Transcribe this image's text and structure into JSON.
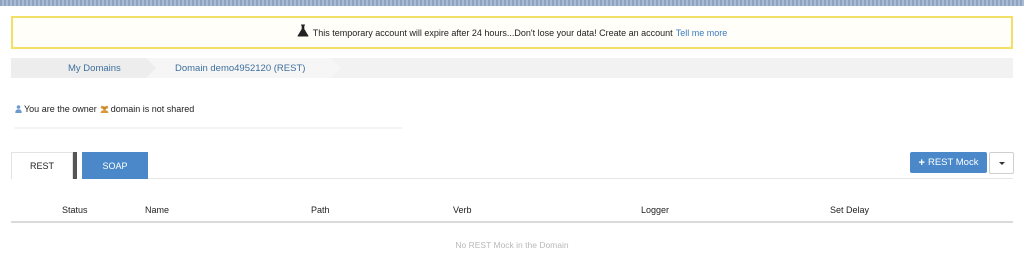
{
  "alert": {
    "message": "This temporary account will expire after 24 hours...Don't lose your data! Create an account",
    "link": "Tell me more",
    "icon": "flask-icon"
  },
  "breadcrumb": {
    "items": [
      {
        "label": "My Domains"
      },
      {
        "label": "Domain demo4952120 (REST)"
      }
    ]
  },
  "owner": {
    "owner_text": "You are the owner",
    "share_text": "domain is not shared",
    "user_icon": "user-icon",
    "share_icon": "group-icon"
  },
  "tabs": [
    {
      "label": "REST",
      "active": true
    },
    {
      "label": "SOAP",
      "active": false
    }
  ],
  "toolbar": {
    "add_label": "REST Mock",
    "add_icon": "plus-icon",
    "dropdown_icon": "caret-down-icon"
  },
  "table": {
    "columns": [
      "Status",
      "Name",
      "Path",
      "Verb",
      "Logger",
      "Set Delay"
    ],
    "empty_text": "No REST Mock in the Domain"
  },
  "colors": {
    "accent": "#4a88c9",
    "alert_border": "#f3de66",
    "link": "#3a7cc2"
  }
}
